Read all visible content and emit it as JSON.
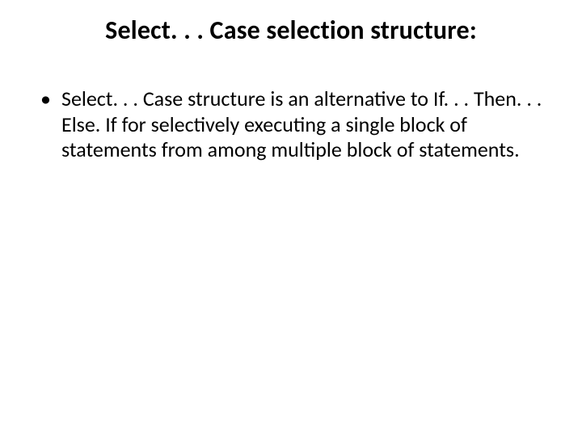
{
  "slide": {
    "title": "Select. . . Case selection structure:",
    "bullets": [
      "Select. . . Case structure is an alternative to If. . . Then. . . Else. If for selectively executing a single block of statements from among multiple block of statements."
    ]
  }
}
